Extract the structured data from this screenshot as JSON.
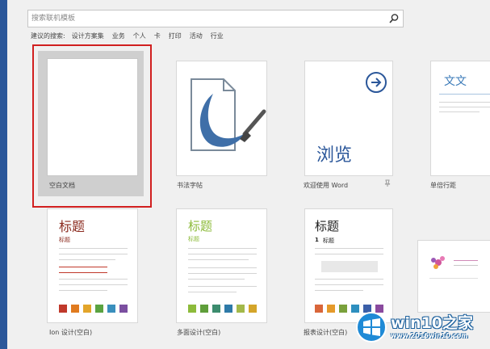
{
  "search": {
    "placeholder": "搜索联机模板"
  },
  "suggested": {
    "lead": "建议的搜索:",
    "items": [
      "设计方案集",
      "业务",
      "个人",
      "卡",
      "打印",
      "活动",
      "行业"
    ]
  },
  "templates": [
    {
      "label": "空白文档"
    },
    {
      "label": "书法字帖"
    },
    {
      "label": "欢迎使用 Word"
    },
    {
      "label": "单倍行距"
    },
    {
      "label": "Ion 设计(空白)"
    },
    {
      "label": "多面设计(空白)"
    },
    {
      "label": "报表设计(空白)"
    }
  ],
  "previews": {
    "welcome_big": "浏览",
    "single_spacing_title": "文文",
    "ion_title": "标题",
    "ion_subtitle": "标题",
    "facet_title": "标题",
    "facet_subtitle": "标题",
    "report_title": "标题",
    "report_heading_num": "1",
    "report_heading": "标题"
  },
  "watermark": {
    "brand": "win10之家",
    "url": "www.2016win10.com"
  },
  "colors": {
    "accent_blue": "#2b579a",
    "selection_red": "#d11f1f",
    "ion_red": "#8b2a1e",
    "facet_green": "#8dbb3b"
  }
}
